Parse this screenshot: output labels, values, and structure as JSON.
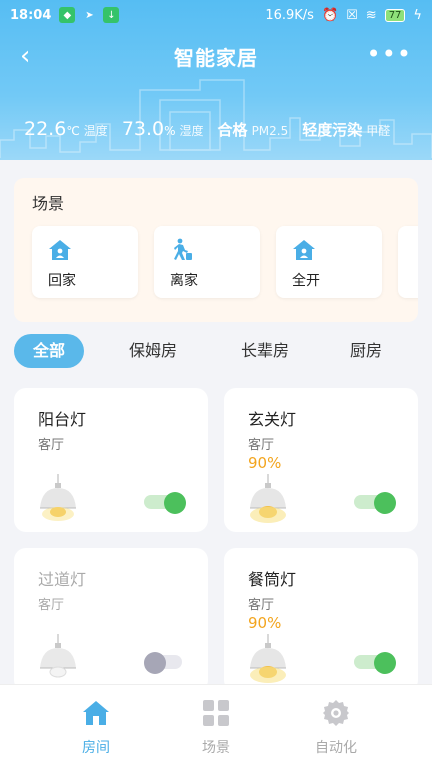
{
  "status_bar": {
    "time": "18:04",
    "speed": "16.9K/s",
    "battery": "77"
  },
  "header": {
    "title": "智能家居",
    "back_glyph": "‹",
    "more_glyph": "•••"
  },
  "weather": {
    "temperature": "22.6",
    "temperature_unit": "℃",
    "temperature_label": "温度",
    "humidity": "73.0",
    "humidity_unit": "%",
    "humidity_label": "湿度",
    "pm_status": "合格",
    "pm_label": "PM2.5",
    "formaldehyde_status": "轻度污染",
    "formaldehyde_label": "甲醛"
  },
  "scenes": {
    "title": "场景",
    "items": [
      {
        "label": "回家",
        "icon": "home-icon"
      },
      {
        "label": "离家",
        "icon": "walking-person-icon"
      },
      {
        "label": "全开",
        "icon": "home-icon"
      }
    ]
  },
  "room_tabs": [
    {
      "label": "全部",
      "active": true
    },
    {
      "label": "保姆房",
      "active": false
    },
    {
      "label": "长辈房",
      "active": false
    },
    {
      "label": "厨房",
      "active": false
    }
  ],
  "devices": [
    {
      "name": "阳台灯",
      "room": "客厅",
      "brightness": "",
      "on": true
    },
    {
      "name": "玄关灯",
      "room": "客厅",
      "brightness": "90%",
      "on": true
    },
    {
      "name": "过道灯",
      "room": "客厅",
      "brightness": "",
      "on": false
    },
    {
      "name": "餐筒灯",
      "room": "客厅",
      "brightness": "90%",
      "on": true
    }
  ],
  "bottom_nav": [
    {
      "label": "房间",
      "icon": "house-icon",
      "active": true
    },
    {
      "label": "场景",
      "icon": "grid-icon",
      "active": false
    },
    {
      "label": "自动化",
      "icon": "gear-icon",
      "active": false
    }
  ],
  "colors": {
    "header_blue": "#56bdf3",
    "accent": "#5ab8ea",
    "toggle_on": "#4cc05c",
    "brightness_text": "#f3a51e",
    "nav_active": "#4aaee6"
  }
}
